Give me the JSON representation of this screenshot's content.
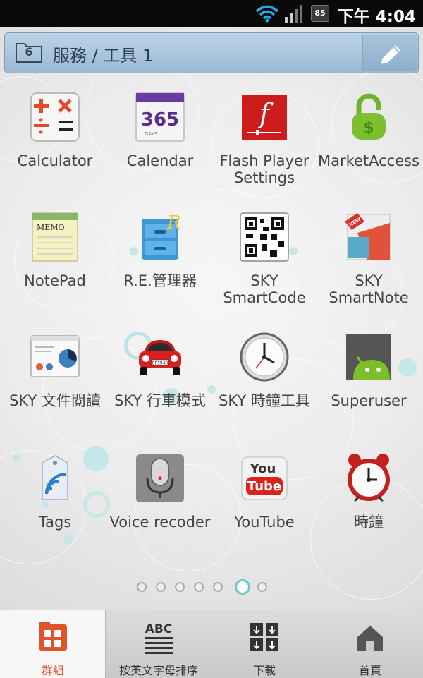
{
  "status_bar": {
    "battery": "85",
    "time": "下午 4:04"
  },
  "folder": {
    "count": "6",
    "title": "服務 / 工具 1"
  },
  "apps": [
    {
      "label": "Calculator",
      "icon": "calculator-icon"
    },
    {
      "label": "Calendar",
      "icon": "calendar-icon",
      "icon_text": "365",
      "icon_sub": "DAYS"
    },
    {
      "label": "Flash Player Settings",
      "icon": "flash-icon",
      "icon_text": "f"
    },
    {
      "label": "MarketAccess",
      "icon": "lock-icon",
      "icon_text": "$"
    },
    {
      "label": "NotePad",
      "icon": "notepad-icon",
      "icon_text": "MEMO"
    },
    {
      "label": "R.E.管理器",
      "icon": "file-cabinet-icon",
      "icon_text": "R"
    },
    {
      "label": "SKY SmartCode",
      "icon": "qr-code-icon"
    },
    {
      "label": "SKY SmartNote",
      "icon": "smartnote-icon",
      "icon_text": "NEW"
    },
    {
      "label": "SKY 文件閱讀",
      "icon": "document-viewer-icon"
    },
    {
      "label": "SKY 行車模式",
      "icon": "car-icon",
      "icon_text": "EF3940"
    },
    {
      "label": "SKY 時鐘工具",
      "icon": "clock-icon"
    },
    {
      "label": "Superuser",
      "icon": "android-icon"
    },
    {
      "label": "Tags",
      "icon": "nfc-tag-icon"
    },
    {
      "label": "Voice recoder",
      "icon": "microphone-icon"
    },
    {
      "label": "YouTube",
      "icon": "youtube-icon",
      "icon_text_1": "You",
      "icon_text_2": "Tube"
    },
    {
      "label": "時鐘",
      "icon": "alarm-clock-icon"
    }
  ],
  "pages": {
    "total": 7,
    "active": 6
  },
  "bottom_nav": [
    {
      "label": "群組",
      "icon": "grid-icon",
      "active": true
    },
    {
      "label": "按英文字母排序",
      "icon": "abc-sort-icon",
      "icon_text": "ABC",
      "active": false
    },
    {
      "label": "下載",
      "icon": "download-icon",
      "active": false
    },
    {
      "label": "首頁",
      "icon": "home-icon",
      "active": false
    }
  ],
  "colors": {
    "accent": "#e0542a",
    "header": "#a9c4db",
    "page_dot_active": "#66cccc"
  }
}
